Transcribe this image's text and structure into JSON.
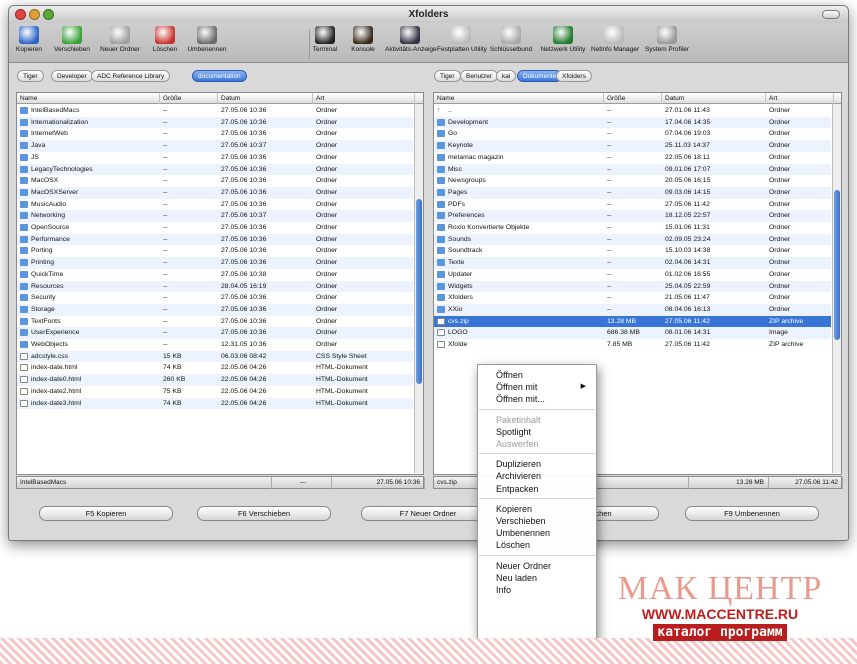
{
  "window": {
    "title": "Xfolders"
  },
  "toolbar": [
    {
      "label": "Kopieren",
      "icon": "copy-icon",
      "color": "#2a62c8"
    },
    {
      "label": "Verschieben",
      "icon": "move-icon",
      "color": "#38a23a"
    },
    {
      "label": "Neuer Ordner",
      "icon": "new-folder-icon",
      "color": "#a0a0a0"
    },
    {
      "label": "Löschen",
      "icon": "delete-icon",
      "color": "#c8322c"
    },
    {
      "label": "Umbenennen",
      "icon": "rename-icon",
      "color": "#6a6a6a"
    },
    {
      "label": "Terminal",
      "icon": "terminal-icon",
      "color": "#222"
    },
    {
      "label": "Konsole",
      "icon": "console-icon",
      "color": "#3a2a1a"
    },
    {
      "label": "Aktivitäts-Anzeige",
      "icon": "activity-monitor-icon",
      "color": "#334"
    },
    {
      "label": "Festplatten Utility",
      "icon": "disk-utility-icon",
      "color": "#bbb"
    },
    {
      "label": "Schlüsselbund",
      "icon": "keychain-icon",
      "color": "#aaa"
    },
    {
      "label": "Netzwerk Utility",
      "icon": "network-utility-icon",
      "color": "#1f7a2a"
    },
    {
      "label": "Netlnfo Manager",
      "icon": "netinfo-icon",
      "color": "#bbb"
    },
    {
      "label": "System Profiler",
      "icon": "system-profiler-icon",
      "color": "#999"
    }
  ],
  "left": {
    "tabs": [
      {
        "label": "Tiger"
      },
      {
        "label": "Developer"
      },
      {
        "label": "ADC Reference Library"
      },
      {
        "label": "documentation"
      }
    ],
    "columns": [
      "Name",
      "Größe",
      "Datum",
      "Art"
    ],
    "rows": [
      {
        "name": "IntelBasedMacs",
        "size": "--",
        "date": "27.05.06 10:36",
        "kind": "Ordner",
        "icon": "folder"
      },
      {
        "name": "Internationalization",
        "size": "--",
        "date": "27.05.06 10:36",
        "kind": "Ordner",
        "icon": "folder"
      },
      {
        "name": "InternetWeb",
        "size": "--",
        "date": "27.05.06 10:36",
        "kind": "Ordner",
        "icon": "folder"
      },
      {
        "name": "Java",
        "size": "--",
        "date": "27.05.06 10:37",
        "kind": "Ordner",
        "icon": "folder"
      },
      {
        "name": "JS",
        "size": "--",
        "date": "27.05.06 10:36",
        "kind": "Ordner",
        "icon": "folder"
      },
      {
        "name": "LegacyTechnologies",
        "size": "--",
        "date": "27.05.06 10:36",
        "kind": "Ordner",
        "icon": "folder"
      },
      {
        "name": "MacOSX",
        "size": "--",
        "date": "27.05.06 10:36",
        "kind": "Ordner",
        "icon": "folder"
      },
      {
        "name": "MacOSXServer",
        "size": "--",
        "date": "27.05.06 10:36",
        "kind": "Ordner",
        "icon": "folder"
      },
      {
        "name": "MusicAudio",
        "size": "--",
        "date": "27.05.06 10:36",
        "kind": "Ordner",
        "icon": "folder"
      },
      {
        "name": "Networking",
        "size": "--",
        "date": "27.05.06 10:37",
        "kind": "Ordner",
        "icon": "folder"
      },
      {
        "name": "OpenSource",
        "size": "--",
        "date": "27.05.06 10:36",
        "kind": "Ordner",
        "icon": "folder"
      },
      {
        "name": "Performance",
        "size": "--",
        "date": "27.05.06 10:36",
        "kind": "Ordner",
        "icon": "folder"
      },
      {
        "name": "Porting",
        "size": "--",
        "date": "27.05.06 10:36",
        "kind": "Ordner",
        "icon": "folder"
      },
      {
        "name": "Printing",
        "size": "--",
        "date": "27.05.06 10:36",
        "kind": "Ordner",
        "icon": "folder"
      },
      {
        "name": "QuickTime",
        "size": "--",
        "date": "27.05.06 10:38",
        "kind": "Ordner",
        "icon": "folder"
      },
      {
        "name": "Resources",
        "size": "--",
        "date": "28.04.05 16:19",
        "kind": "Ordner",
        "icon": "folder"
      },
      {
        "name": "Security",
        "size": "--",
        "date": "27.05.06 10:36",
        "kind": "Ordner",
        "icon": "folder"
      },
      {
        "name": "Storage",
        "size": "--",
        "date": "27.05.06 10:36",
        "kind": "Ordner",
        "icon": "folder"
      },
      {
        "name": "TextFonts",
        "size": "--",
        "date": "27.05.06 10:36",
        "kind": "Ordner",
        "icon": "folder"
      },
      {
        "name": "UserExperience",
        "size": "--",
        "date": "27.05.06 10:36",
        "kind": "Ordner",
        "icon": "folder"
      },
      {
        "name": "WebObjects",
        "size": "--",
        "date": "12.31.05 10:36",
        "kind": "Ordner",
        "icon": "folder"
      },
      {
        "name": "adcstyle.css",
        "size": "15 KB",
        "date": "06.03.06 08:42",
        "kind": "CSS Style Sheet",
        "icon": "doc"
      },
      {
        "name": "index-date.html",
        "size": "74 KB",
        "date": "22.05.06 04:26",
        "kind": "HTML-Dokument",
        "icon": "doc"
      },
      {
        "name": "index-date0.html",
        "size": "260 KB",
        "date": "22.05.06 04:26",
        "kind": "HTML-Dokument",
        "icon": "doc"
      },
      {
        "name": "index-date2.html",
        "size": "75 KB",
        "date": "22.05.06 04:26",
        "kind": "HTML-Dokument",
        "icon": "doc"
      },
      {
        "name": "index-date3.html",
        "size": "74 KB",
        "date": "22.05.06 04:26",
        "kind": "HTML-Dokument",
        "icon": "doc"
      }
    ],
    "status": {
      "path": "IntelBasedMacs",
      "size": "---",
      "date": "27.05.06 10:36"
    }
  },
  "right": {
    "tabs": [
      {
        "label": "Tiger"
      },
      {
        "label": "Benutzer"
      },
      {
        "label": "kai"
      },
      {
        "label": "Dokumente"
      },
      {
        "label": "Xfolders"
      }
    ],
    "columns": [
      "Name",
      "Größe",
      "Datum",
      "Art"
    ],
    "rows": [
      {
        "name": "..",
        "size": "--",
        "date": "27.01.06 11:43",
        "kind": "Ordner",
        "icon": "up"
      },
      {
        "name": "Development",
        "size": "--",
        "date": "17.04.06 14:35",
        "kind": "Ordner",
        "icon": "folder"
      },
      {
        "name": "Go",
        "size": "--",
        "date": "07.04.06 19:03",
        "kind": "Ordner",
        "icon": "folder"
      },
      {
        "name": "Keynote",
        "size": "--",
        "date": "25.11.03 14:37",
        "kind": "Ordner",
        "icon": "folder"
      },
      {
        "name": "metamac magazin",
        "size": "--",
        "date": "22.05.06 18:11",
        "kind": "Ordner",
        "icon": "folder"
      },
      {
        "name": "Misc",
        "size": "--",
        "date": "09.01.06 17:07",
        "kind": "Ordner",
        "icon": "folder"
      },
      {
        "name": "Newsgroups",
        "size": "--",
        "date": "20.05.06 16:15",
        "kind": "Ordner",
        "icon": "folder"
      },
      {
        "name": "Pages",
        "size": "--",
        "date": "09.03.06 14:15",
        "kind": "Ordner",
        "icon": "folder"
      },
      {
        "name": "PDFs",
        "size": "--",
        "date": "27.05.06 11:42",
        "kind": "Ordner",
        "icon": "folder"
      },
      {
        "name": "Preferences",
        "size": "--",
        "date": "18.12.05 22:57",
        "kind": "Ordner",
        "icon": "folder"
      },
      {
        "name": "Roxio Konvertierte Objekte",
        "size": "--",
        "date": "15.01.06 11:31",
        "kind": "Ordner",
        "icon": "folder"
      },
      {
        "name": "Sounds",
        "size": "--",
        "date": "02.09.05 23:24",
        "kind": "Ordner",
        "icon": "folder"
      },
      {
        "name": "Soundtrack",
        "size": "--",
        "date": "15.10.03 14:38",
        "kind": "Ordner",
        "icon": "folder"
      },
      {
        "name": "Texte",
        "size": "--",
        "date": "02.04.06 14:31",
        "kind": "Ordner",
        "icon": "folder"
      },
      {
        "name": "Updater",
        "size": "--",
        "date": "01.02.06 16:55",
        "kind": "Ordner",
        "icon": "folder"
      },
      {
        "name": "Widgets",
        "size": "--",
        "date": "25.04.05 22:59",
        "kind": "Ordner",
        "icon": "folder"
      },
      {
        "name": "Xfolders",
        "size": "--",
        "date": "21.05.06 11:47",
        "kind": "Ordner",
        "icon": "folder"
      },
      {
        "name": "XXio",
        "size": "--",
        "date": "08.04.06 16:13",
        "kind": "Ordner",
        "icon": "folder"
      },
      {
        "name": "cvs.zip",
        "size": "13.28 MB",
        "date": "27.05.06 11:42",
        "kind": "ZIP archive",
        "icon": "doc",
        "selected": true
      },
      {
        "name": "LOGO",
        "size": "686.38 MB",
        "date": "08.01.06 14:31",
        "kind": "Image",
        "icon": "doc"
      },
      {
        "name": "Xfolde",
        "size": "7.85 MB",
        "date": "27.05.06 11:42",
        "kind": "ZIP archive",
        "icon": "doc"
      }
    ],
    "status": {
      "path": "cvs.zip",
      "size": "13.28 MB",
      "date": "27.05.06 11:42"
    }
  },
  "fkeys": [
    {
      "label": "F5 Kopieren"
    },
    {
      "label": "F6 Verschieben"
    },
    {
      "label": "F7 Neuer Ordner"
    },
    {
      "label": "F8 Löschen"
    },
    {
      "label": "F9 Umbenennen"
    }
  ],
  "context_menu": [
    {
      "label": "Öffnen",
      "disabled": false
    },
    {
      "label": "Öffnen mit",
      "disabled": false,
      "submenu": true
    },
    {
      "label": "Öffnen mit...",
      "disabled": false
    },
    {
      "sep": true
    },
    {
      "label": "Paketinhalt",
      "disabled": true
    },
    {
      "label": "Spotlight",
      "disabled": false
    },
    {
      "label": "Auswerfen",
      "disabled": true
    },
    {
      "sep": true
    },
    {
      "label": "Duplizieren",
      "disabled": false
    },
    {
      "label": "Archivieren",
      "disabled": false
    },
    {
      "label": "Entpacken",
      "disabled": false
    },
    {
      "sep": true
    },
    {
      "label": "Kopieren",
      "disabled": false
    },
    {
      "label": "Verschieben",
      "disabled": false
    },
    {
      "label": "Umbenennen",
      "disabled": false
    },
    {
      "label": "Löschen",
      "disabled": false
    },
    {
      "sep": true
    },
    {
      "label": "Neuer Ordner",
      "disabled": false
    },
    {
      "label": "Neu laden",
      "disabled": false
    },
    {
      "label": "Info",
      "disabled": false
    }
  ],
  "watermark": {
    "line1": "МАК ЦЕНТР",
    "line2": "WWW.MACCENTRE.RU",
    "line3": "каталог программ"
  }
}
